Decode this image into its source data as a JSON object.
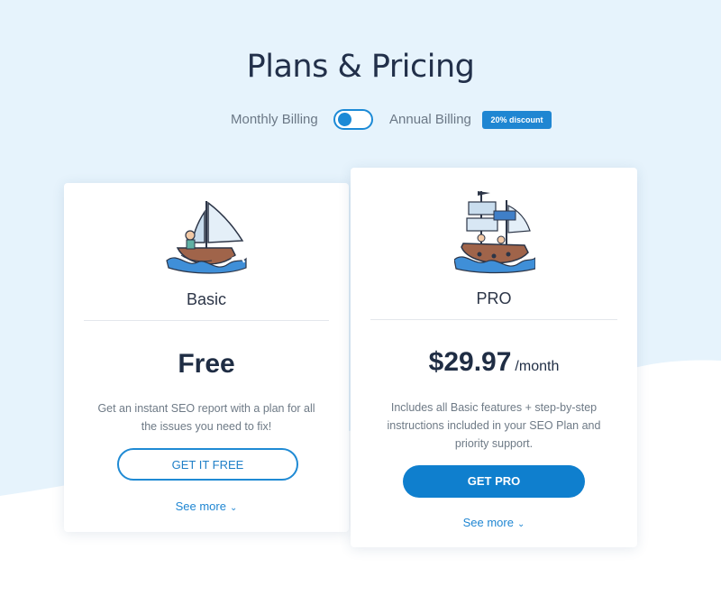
{
  "page": {
    "title": "Plans & Pricing",
    "colors": {
      "background_top": "#e6f3fc",
      "accent": "#1f86d2",
      "text_dark": "#1f2d44"
    }
  },
  "billing": {
    "monthly_label": "Monthly Billing",
    "annual_label": "Annual Billing",
    "discount_badge": "20% discount",
    "selected": "Monthly Billing"
  },
  "plans": [
    {
      "name": "Basic",
      "price": "Free",
      "description": "Get an instant SEO report with a plan for all the issues you need to fix!",
      "cta_label": "GET IT FREE",
      "see_more_label": "See more",
      "illustration": "sailboat-icon"
    },
    {
      "name": "PRO",
      "price": "$29.97",
      "period": "/month",
      "description": "Includes all Basic features + step-by-step instructions included in your SEO Plan and priority support.",
      "cta_label": "GET PRO",
      "see_more_label": "See more",
      "illustration": "pirate-ship-icon"
    }
  ]
}
